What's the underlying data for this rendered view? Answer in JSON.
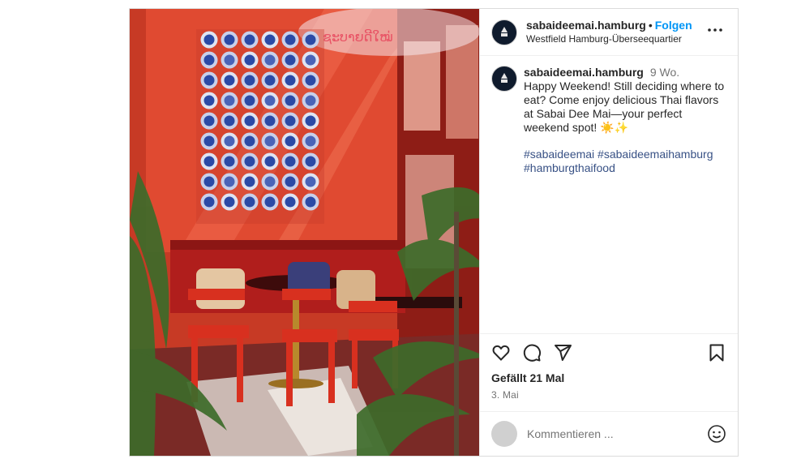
{
  "account": {
    "username": "sabaideemai.hamburg",
    "follow_label": "Folgen",
    "location": "Westfield Hamburg-Überseequartier"
  },
  "caption": {
    "username": "sabaideemai.hamburg",
    "age": "9 Wo.",
    "text": "Happy Weekend! Still deciding where to eat? Come enjoy delicious Thai flavors at Sabai Dee Mai—your perfect weekend spot! ☀️✨",
    "hashtags": "#sabaideemai #sabaideemaihamburg #hamburgthaifood"
  },
  "engagement": {
    "likes": "Gefällt 21 Mal",
    "date": "3. Mai"
  },
  "comment": {
    "placeholder": "Kommentieren ..."
  },
  "icons": {
    "like": "heart-icon",
    "comment": "comment-icon",
    "share": "send-icon",
    "save": "bookmark-icon",
    "options": "more-icon",
    "emoji": "emoji-icon"
  },
  "colors": {
    "link_blue": "#0095f6",
    "hashtag_blue": "#385185",
    "wall_red": "#d94a32",
    "chair_red": "#c8231c",
    "plate_blue": "#2b4aa6"
  }
}
